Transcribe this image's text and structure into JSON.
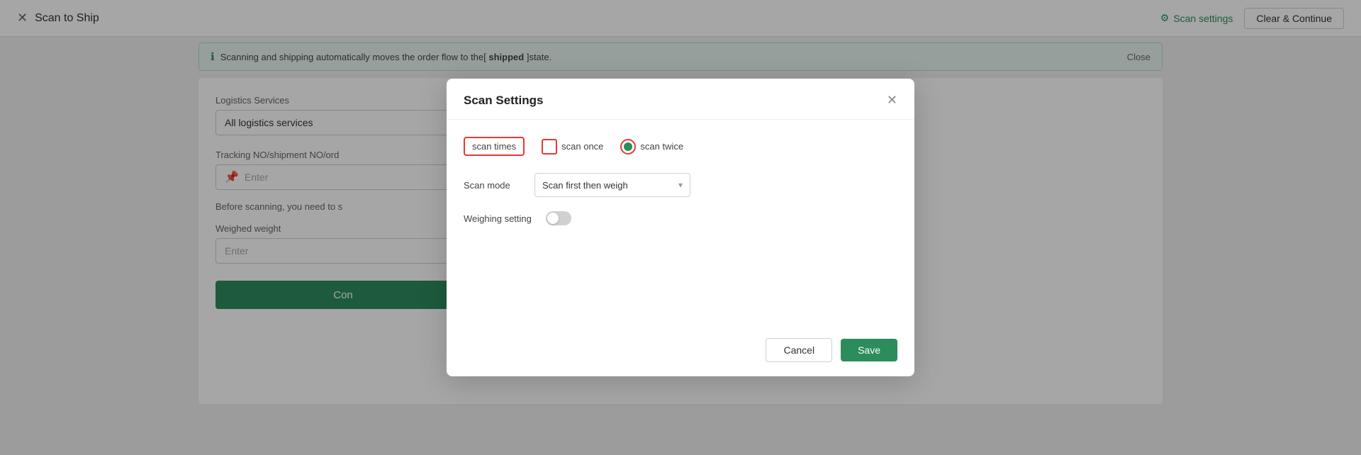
{
  "topbar": {
    "title": "Scan to Ship",
    "scan_settings_label": "Scan settings",
    "clear_continue_label": "Clear & Continue"
  },
  "banner": {
    "text_prefix": "Scanning and shipping automatically moves the order flow to the[",
    "status_word": " shipped ",
    "text_suffix": "]state.",
    "close_label": "Close"
  },
  "background_form": {
    "logistics_services_label": "Logistics Services",
    "logistics_services_value": "All logistics services",
    "tracking_label": "Tracking NO/shipment NO/ord",
    "tracking_placeholder": "Enter",
    "before_scan_text": "Before scanning, you need to s",
    "weighed_weight_label": "Weighed weight",
    "weighed_placeholder": "Enter",
    "confirm_label": "Con"
  },
  "modal": {
    "title": "Scan Settings",
    "scan_times_label": "scan times",
    "scan_once_label": "scan once",
    "scan_twice_label": "scan twice",
    "scan_mode_label": "Scan mode",
    "scan_mode_value": "Scan first then weigh",
    "weighing_setting_label": "Weighing setting",
    "cancel_label": "Cancel",
    "save_label": "Save"
  }
}
